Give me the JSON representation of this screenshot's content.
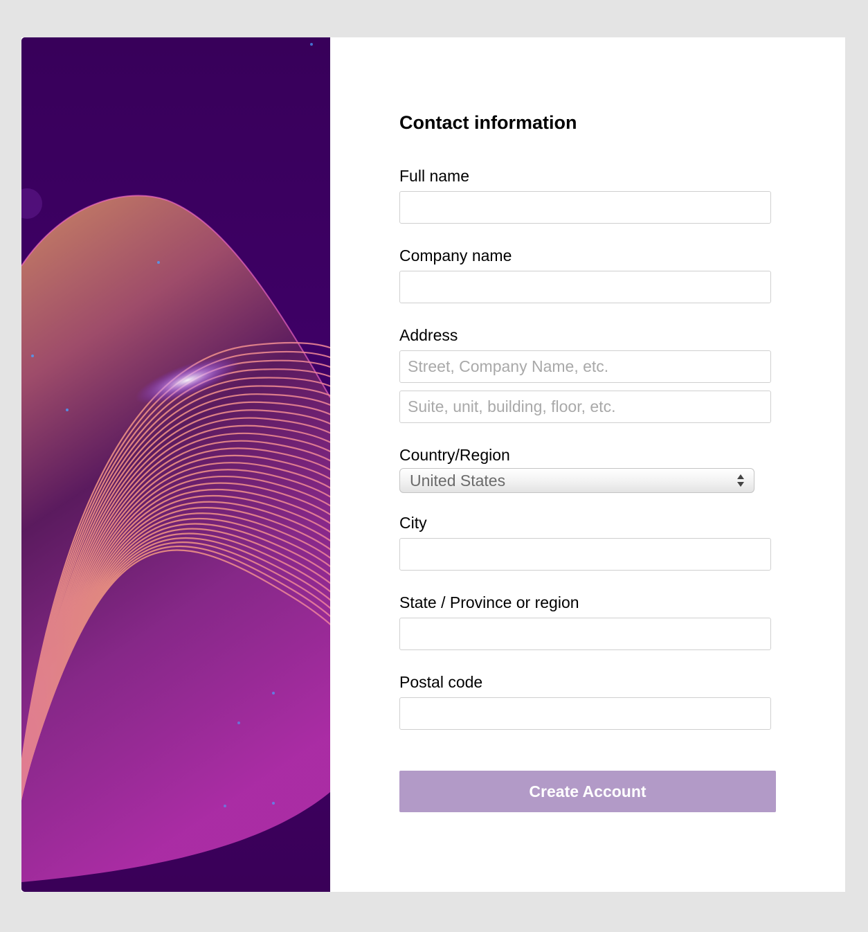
{
  "form": {
    "heading": "Contact information",
    "full_name": {
      "label": "Full name",
      "value": "",
      "placeholder": ""
    },
    "company_name": {
      "label": "Company name",
      "value": "",
      "placeholder": ""
    },
    "address": {
      "label": "Address",
      "line1_placeholder": "Street, Company Name, etc.",
      "line2_placeholder": "Suite, unit, building, floor, etc."
    },
    "country": {
      "label": "Country/Region",
      "selected": "United States"
    },
    "city": {
      "label": "City",
      "value": ""
    },
    "state": {
      "label": "State / Province or region",
      "value": ""
    },
    "postal_code": {
      "label": "Postal code",
      "value": ""
    },
    "submit_label": "Create Account"
  },
  "colors": {
    "page_background": "#e4e4e4",
    "art_background": "#3b0057",
    "button": "#b29ac7"
  }
}
